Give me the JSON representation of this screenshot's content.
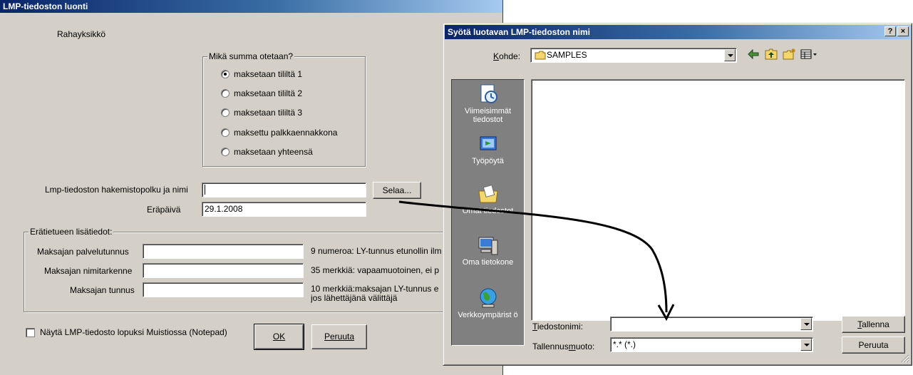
{
  "main": {
    "title": "LMP-tiedoston luonti",
    "currency_label": "Rahayksikkö",
    "amount_group": {
      "legend": "Mikä summa otetaan?",
      "options": [
        {
          "label": "maksetaan tililtä 1",
          "checked": true
        },
        {
          "label": "maksetaan tililtä 2",
          "checked": false
        },
        {
          "label": "maksetaan tililtä 3",
          "checked": false
        },
        {
          "label": "maksettu palkkaennakkona",
          "checked": false
        },
        {
          "label": "maksetaan yhteensä",
          "checked": false
        }
      ]
    },
    "path_label": "Lmp-tiedoston hakemistopolku ja nimi",
    "path_value": "",
    "browse_button": "Selaa...",
    "due_date_label": "Eräpäivä",
    "due_date_value": "29.1.2008",
    "batch_group": {
      "legend": "Erätietueen lisätiedot:",
      "rows": [
        {
          "label": "Maksajan palvelutunnus",
          "value": "",
          "hint": "9 numeroa: LY-tunnus etunollin ilm"
        },
        {
          "label": "Maksajan nimitarkenne",
          "value": "",
          "hint": "35 merkkiä: vapaamuotoinen, ei p"
        },
        {
          "label": "Maksajan tunnus",
          "value": "",
          "hint": "10 merkkiä:maksajan LY-tunnus e",
          "hint2": "jos lähettäjänä välittäjä"
        }
      ]
    },
    "notepad_checkbox": "Näytä LMP-tiedosto lopuksi Muistiossa (Notepad)",
    "notepad_checked": false,
    "ok_button": "OK",
    "cancel_button": "Peruuta"
  },
  "save": {
    "title": "Syötä luotavan LMP-tiedoston nimi",
    "help_button": "?",
    "close_button": "×",
    "location_label": "Kohde:",
    "location_value": "SAMPLES",
    "places": [
      {
        "label": "Viimeisimmät tiedostot",
        "icon": "recent-documents-icon"
      },
      {
        "label": "Työpöytä",
        "icon": "desktop-icon"
      },
      {
        "label": "Omat tiedostot",
        "icon": "my-documents-icon"
      },
      {
        "label": "Oma tietokone",
        "icon": "my-computer-icon"
      },
      {
        "label": "Verkkoympärist ö",
        "icon": "network-icon"
      }
    ],
    "filename_label": "Tiedostonimi:",
    "filename_value": "",
    "filetype_label": "Tallennusmuoto:",
    "filetype_value": "*.* (*.)",
    "save_button": "Tallenna",
    "cancel_button": "Peruuta"
  },
  "colors": {
    "dialog_face": "#d4d0c8",
    "title_active": "#0a246a",
    "annotation_arrow": "#000000"
  }
}
